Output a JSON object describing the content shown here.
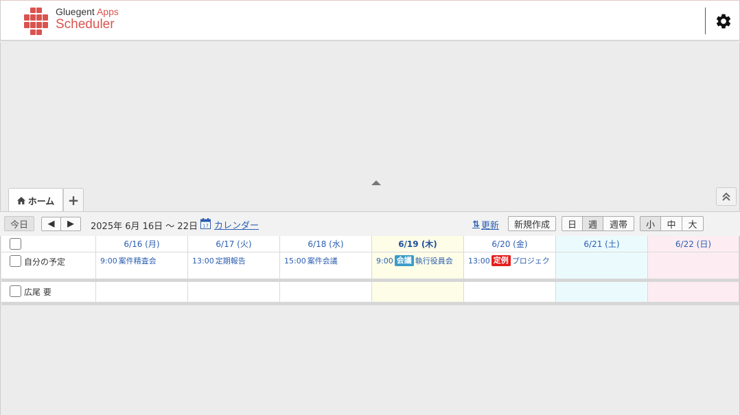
{
  "brand": {
    "name": "Gluegent",
    "apps": "Apps",
    "product": "Scheduler",
    "accent": "#d9534f"
  },
  "tabs": {
    "home_label": "ホーム",
    "add_label": "+"
  },
  "toolbar": {
    "today_label": "今日",
    "prev_label": "◀",
    "next_label": "▶",
    "range_text": "2025年 6月 16日 ～ 22日",
    "calendar_label": "カレンダー",
    "refresh_label": "更新",
    "new_label": "新規作成",
    "view_day": "日",
    "view_week": "週",
    "view_weekband": "週帯",
    "size_small": "小",
    "size_medium": "中",
    "size_large": "大"
  },
  "days": [
    {
      "label": "6/16 (月)"
    },
    {
      "label": "6/17 (火)"
    },
    {
      "label": "6/18 (水)"
    },
    {
      "label": "6/19 (木)"
    },
    {
      "label": "6/20 (金)"
    },
    {
      "label": "6/21 (土)"
    },
    {
      "label": "6/22 (日)"
    }
  ],
  "rows": {
    "my_label": "自分の予定",
    "user_label": "広尾 要"
  },
  "events": {
    "mon": {
      "time": "9:00",
      "title": "案件精査会"
    },
    "tue": {
      "time": "13:00",
      "title": "定期報告"
    },
    "wed": {
      "time": "15:00",
      "title": "案件会議"
    },
    "thu": {
      "time": "9:00",
      "tag": "会議",
      "title": "執行役員会"
    },
    "fri": {
      "time": "13:00",
      "tag": "定例",
      "title": "プロジェク"
    }
  },
  "colors": {
    "link": "#2a5db0",
    "today_bg": "#fdfde8",
    "sat_bg": "#ebfbfd",
    "sun_bg": "#fdedf2",
    "tag_meeting": "#3a9bc8",
    "tag_regular": "#e51c1c"
  }
}
